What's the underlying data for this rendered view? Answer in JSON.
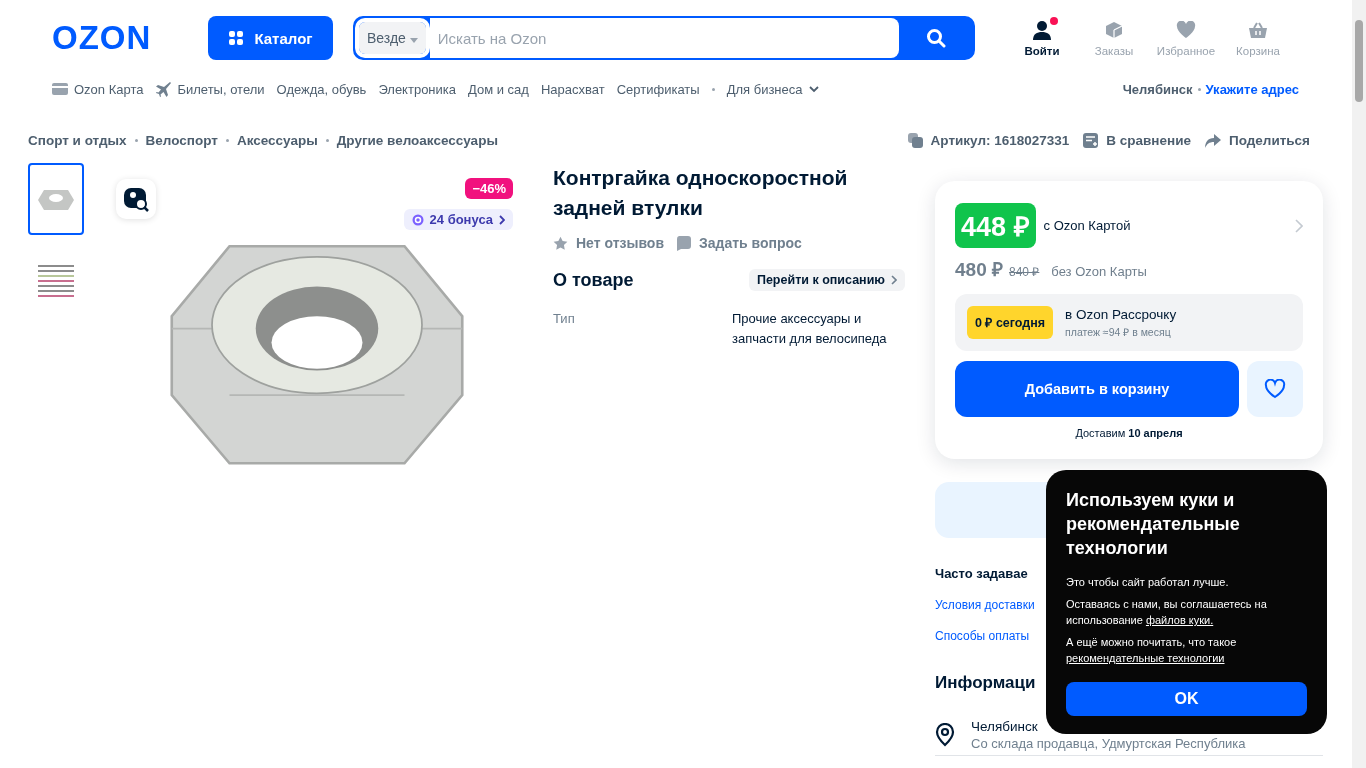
{
  "header": {
    "logo": "OZON",
    "catalog_button": "Каталог",
    "search": {
      "scope": "Везде",
      "placeholder": "Искать на Ozon"
    },
    "actions": [
      {
        "label": "Войти",
        "kind": "user",
        "notification": true
      },
      {
        "label": "Заказы",
        "kind": "box",
        "notification": false
      },
      {
        "label": "Избранное",
        "kind": "heart",
        "notification": false
      },
      {
        "label": "Корзина",
        "kind": "basket",
        "notification": false
      }
    ]
  },
  "nav": {
    "items": [
      {
        "label": "Ozon Карта",
        "kind": "card"
      },
      {
        "label": "Билеты, отели",
        "kind": "plane"
      },
      {
        "label": "Одежда, обувь",
        "kind": "plain"
      },
      {
        "label": "Электроника",
        "kind": "plain"
      },
      {
        "label": "Дом и сад",
        "kind": "plain"
      },
      {
        "label": "Нарасхват",
        "kind": "plain"
      },
      {
        "label": "Сертификаты",
        "kind": "plain"
      },
      {
        "label": "Для бизнеса",
        "kind": "dropdown"
      }
    ],
    "city": "Челябинск",
    "address_link": "Укажите адрес"
  },
  "breadcrumbs": [
    "Спорт и отдых",
    "Велоспорт",
    "Аксессуары",
    "Другие велоаксессуары"
  ],
  "product_actions": [
    {
      "label": "Артикул: 1618027331",
      "kind": "copy"
    },
    {
      "label": "В сравнение",
      "kind": "compare"
    },
    {
      "label": "Поделиться",
      "kind": "share"
    }
  ],
  "gallery": {
    "thumbnails": [
      {
        "selected": true
      },
      {
        "selected": false
      }
    ],
    "discount": "−46%",
    "bonus": "24 бонуса"
  },
  "product": {
    "title": "Контргайка односкоростной задней втулки",
    "reviews": "Нет отзывов",
    "ask": "Задать вопрос",
    "about_heading": "О товаре",
    "to_description": "Перейти к описанию",
    "specs": [
      {
        "name": "Тип",
        "value": "Прочие аксессуары и запчасти для велосипеда"
      }
    ]
  },
  "price_card": {
    "card_price": "448 ₽",
    "card_price_label": "с Ozon Картой",
    "price": "480 ₽",
    "old_price": "840 ₽",
    "price_label": "без Ozon Карты",
    "installment": {
      "badge": "0 ₽ сегодня",
      "title": "в Ozon Рассрочку",
      "subtitle": "платеж ≈94 ₽ в месяц"
    },
    "add_to_cart": "Добавить в корзину",
    "delivery": "Доставим **10 апреля**"
  },
  "faq": {
    "heading": "Часто задавае",
    "links": [
      "Условия доставки",
      "Способы оплаты"
    ]
  },
  "info": {
    "heading": "Информаци",
    "location": "Челябинск",
    "warehouse": "Со склада продавца, Удмуртская Республика"
  },
  "cookie_popup": {
    "title": "Используем куки и рекомендательные технологии",
    "paragraphs": [
      {
        "text": "Это чтобы сайт работал лучше."
      },
      {
        "text": "Оставаясь с нами, вы соглашаетесь на использование ",
        "link": "файлов куки."
      },
      {
        "text": "А ещё можно почитать, что такое ",
        "link": "рекомендательные технологии"
      }
    ],
    "ok_button": "OK"
  }
}
